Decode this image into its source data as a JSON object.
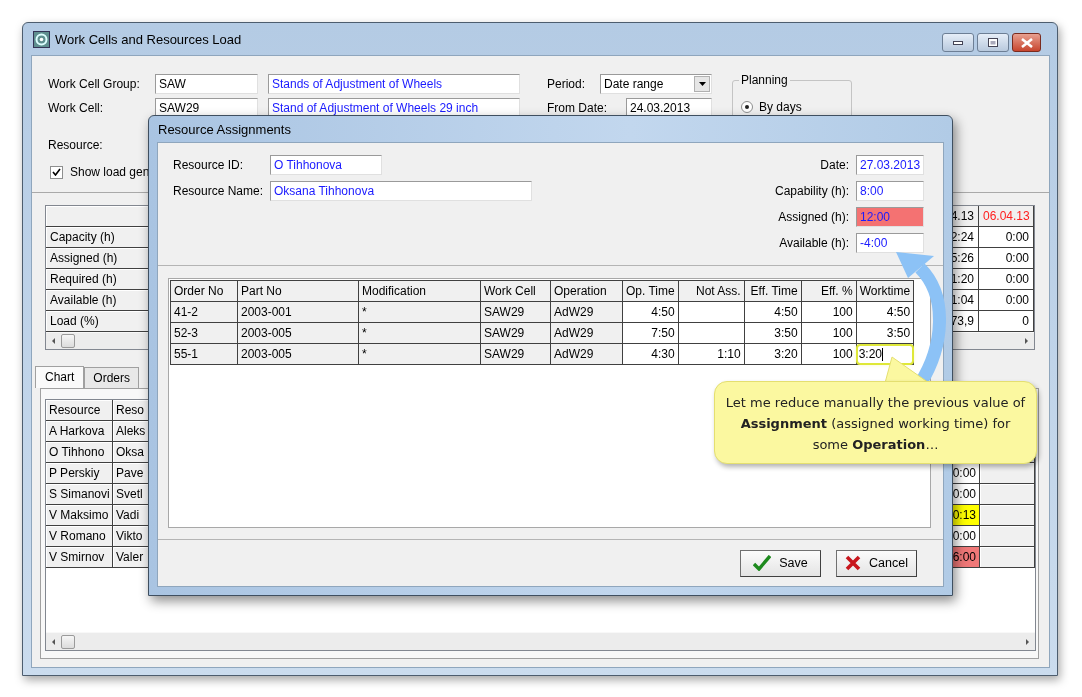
{
  "window": {
    "title": "Work Cells and Resources Load"
  },
  "form": {
    "work_cell_group": {
      "label": "Work Cell Group:",
      "code": "SAW",
      "name": "Stands of Adjustment of Wheels"
    },
    "work_cell": {
      "label": "Work Cell:",
      "code": "SAW29",
      "name": "Stand of Adjustment of Wheels 29 inch"
    },
    "resource": {
      "label": "Resource:"
    },
    "period": {
      "label": "Period:",
      "value": "Date range"
    },
    "from_date": {
      "label": "From Date:",
      "value": "24.03.2013"
    },
    "show_load": {
      "label": "Show load gen",
      "checked": true
    }
  },
  "planning": {
    "title": "Planning",
    "options": [
      {
        "label": "By days",
        "selected": true
      }
    ]
  },
  "load_grid": {
    "rows": [
      "Capacity (h)",
      "Assigned (h)",
      "Required (h)",
      "Available (h)",
      "Load (%)"
    ],
    "columns": [
      {
        "header": "4.13",
        "weekend": false,
        "values": [
          "2:24",
          "5:26",
          "1:20",
          "1:04",
          "73,9"
        ]
      },
      {
        "header": "06.04.13",
        "weekend": true,
        "values": [
          "0:00",
          "0:00",
          "0:00",
          "0:00",
          "0"
        ]
      }
    ]
  },
  "tabs": [
    {
      "label": "Chart",
      "selected": true
    },
    {
      "label": "Orders",
      "selected": false
    }
  ],
  "resource_grid": {
    "columns": [
      "Resource",
      "Reso"
    ],
    "rows": [
      {
        "resource": "A Harkova",
        "name": "Aleks"
      },
      {
        "resource": "O Tihhono",
        "name": "Oksa"
      },
      {
        "resource": "P Perskiy",
        "name": "Pave",
        "value": "0:00"
      },
      {
        "resource": "S Simanovi",
        "name": "Svetl",
        "value": "0:00"
      },
      {
        "resource": "V Maksimo",
        "name": "Vadi",
        "value": "0:13",
        "color": "#ffff00"
      },
      {
        "resource": "V Romano",
        "name": "Vikto",
        "value": "0:00"
      },
      {
        "resource": "V Smirnov",
        "name": "Valer",
        "value": "6:00",
        "color": "#f07878"
      }
    ]
  },
  "dialog": {
    "title": "Resource Assignments",
    "left_fields": [
      {
        "label": "Resource ID:",
        "value": "O Tihhonova"
      },
      {
        "label": "Resource Name:",
        "value": "Oksana Tihhonova"
      }
    ],
    "right_fields": [
      {
        "label": "Date:",
        "value": "27.03.2013",
        "alert": false
      },
      {
        "label": "Capability (h):",
        "value": "8:00",
        "alert": false
      },
      {
        "label": "Assigned (h):",
        "value": "12:00",
        "alert": true
      },
      {
        "label": "Available (h):",
        "value": "-4:00",
        "alert": false
      }
    ],
    "table": {
      "columns": [
        {
          "label": "Order No",
          "kind": "text"
        },
        {
          "label": "Part No",
          "kind": "text"
        },
        {
          "label": "Modification",
          "kind": "text"
        },
        {
          "label": "Work Cell",
          "kind": "text"
        },
        {
          "label": "Operation",
          "kind": "text"
        },
        {
          "label": "Op. Time",
          "kind": "number"
        },
        {
          "label": "Not Ass.",
          "kind": "number"
        },
        {
          "label": "Eff. Time",
          "kind": "number"
        },
        {
          "label": "Eff. %",
          "kind": "number"
        },
        {
          "label": "Worktime",
          "kind": "number"
        }
      ],
      "rows": [
        {
          "editing": false,
          "cells": [
            "41-2",
            "2003-001",
            "*",
            "SAW29",
            "AdW29",
            "4:50",
            null,
            "4:50",
            "100",
            "4:50"
          ]
        },
        {
          "editing": false,
          "cells": [
            "52-3",
            "2003-005",
            "*",
            "SAW29",
            "AdW29",
            "7:50",
            null,
            "3:50",
            "100",
            "3:50"
          ]
        },
        {
          "editing": true,
          "cells": [
            "55-1",
            "2003-005",
            "*",
            "SAW29",
            "AdW29",
            "4:30",
            "1:10",
            "3:20",
            "100",
            "3:20"
          ]
        }
      ]
    },
    "buttons": [
      {
        "label": "Save",
        "kind": "save"
      },
      {
        "label": "Cancel",
        "kind": "cancel"
      }
    ]
  },
  "callout": {
    "text": "Let me reduce manually the previous value of **Assignment** (assigned working time) for some **Operation**…"
  }
}
